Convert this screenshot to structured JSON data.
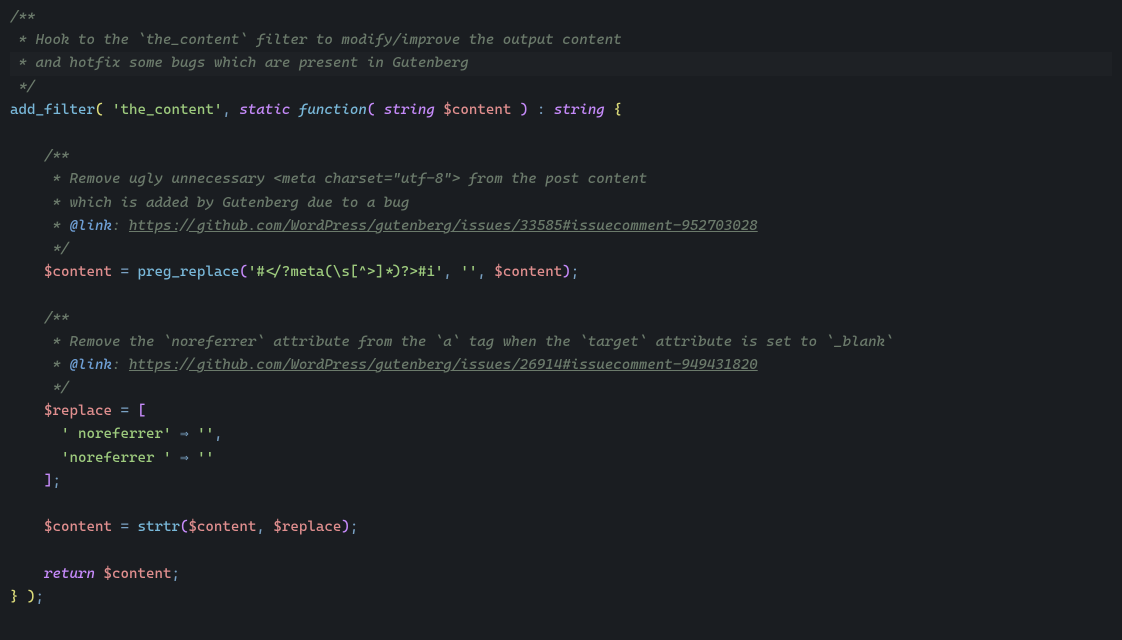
{
  "code": {
    "doc1_open": "/**",
    "doc1_l1": " * Hook to the `the_content` filter to modify/improve the output content",
    "doc1_l2": " * and hotfix some bugs which are present in Gutenberg",
    "doc1_close": " */",
    "fn_add_filter": "add_filter",
    "arg_the_content": "'the_content'",
    "kw_static": "static",
    "kw_function": "function",
    "type_string1": "string",
    "var_content": "$content",
    "type_string2": "string",
    "doc2_open": "/**",
    "doc2_l1": "     * Remove ugly unnecessary <meta charset=\"utf-8\"> from the post content",
    "doc2_l2": "     * which is added by Gutenberg due to a bug",
    "doc2_at": "@link",
    "doc2_link": "https://github.com/WordPress/gutenberg/issues/33585#issuecomment-952703028",
    "doc2_close": "     */",
    "fn_preg_replace": "preg_replace",
    "regex": "'#</?meta(\\s[^>]*)?>#i'",
    "empty_str": "''",
    "doc3_open": "/**",
    "doc3_l1": "     * Remove the `noreferrer` attribute from the `a` tag when the `target` attribute is set to `_blank`",
    "doc3_at": "@link",
    "doc3_link": "https://github.com/WordPress/gutenberg/issues/26914#issuecomment-949431820",
    "doc3_close": "     */",
    "var_replace": "$replace",
    "str_noref1": "' noreferrer'",
    "str_noref2": "'noreferrer '",
    "fn_strtr": "strtr",
    "kw_return": "return"
  }
}
